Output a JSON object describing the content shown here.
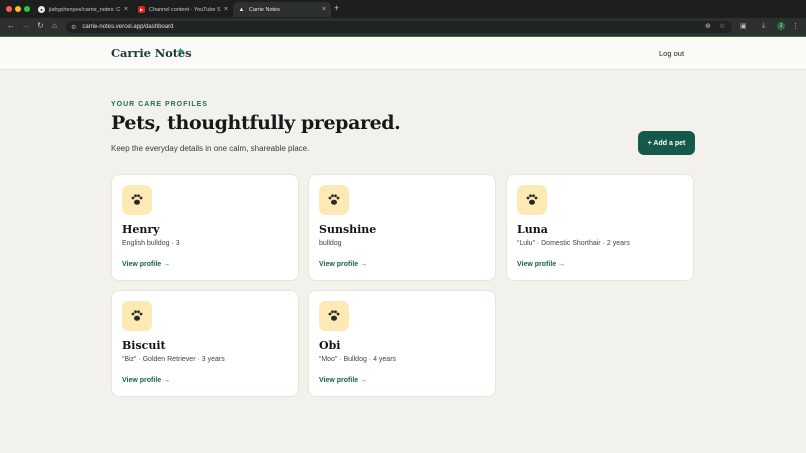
{
  "browser": {
    "tabs": [
      {
        "title": "jiahyphenyee/carrie_notes: C",
        "icon": "github-icon"
      },
      {
        "title": "Channel content - YouTube S",
        "icon": "youtube-icon"
      },
      {
        "title": "Carrie Notes",
        "icon": "vercel-icon"
      }
    ],
    "url": "carrie-notes.vercel.app/dashboard",
    "profile_initial": "J"
  },
  "header": {
    "logo_text": "Carrie Notes",
    "logo_mark": "✦",
    "logout_label": "Log out"
  },
  "hero": {
    "eyebrow": "YOUR CARE PROFILES",
    "title": "Pets, thoughtfully prepared.",
    "subtitle": "Keep the everyday details in one calm, shareable place.",
    "add_button": "+ Add a pet"
  },
  "pets": [
    {
      "name": "Henry",
      "meta": "English bulldog · 3",
      "link": "View profile →"
    },
    {
      "name": "Sunshine",
      "meta": "bulldog",
      "link": "View profile →"
    },
    {
      "name": "Luna",
      "meta": "“Lulu” · Domestic Shorthair · 2 years",
      "link": "View profile →"
    },
    {
      "name": "Biscuit",
      "meta": "“Biz” · Golden Retriever · 3 years",
      "link": "View profile →"
    },
    {
      "name": "Obi",
      "meta": "“Moo” · Bulldog · 4 years",
      "link": "View profile →"
    }
  ],
  "colors": {
    "accent": "#14594c",
    "paw_bg": "#fde9b3",
    "page_bg": "#f3f1ec"
  }
}
